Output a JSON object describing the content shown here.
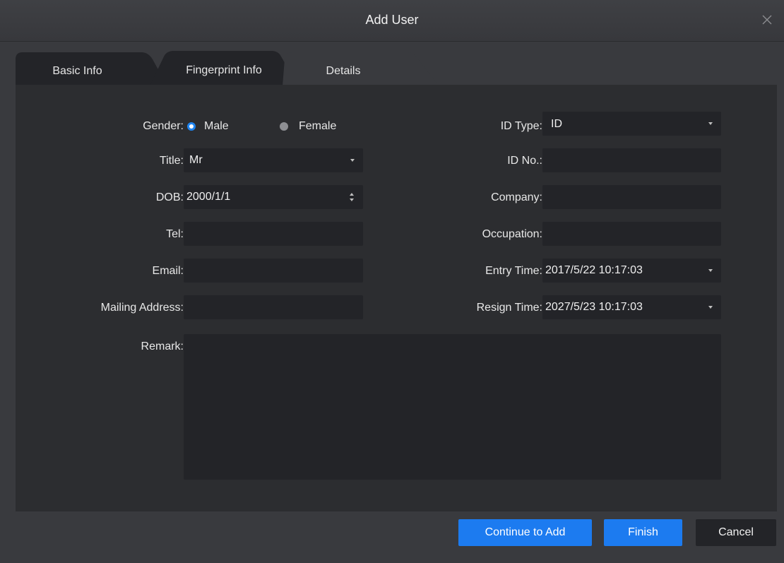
{
  "window": {
    "title": "Add User"
  },
  "tabs": [
    {
      "label": "Basic Info",
      "active": false
    },
    {
      "label": "Fingerprint Info",
      "active": false
    },
    {
      "label": "Details",
      "active": true
    }
  ],
  "form": {
    "gender": {
      "label": "Gender:",
      "options": [
        "Male",
        "Female"
      ],
      "selected": "Male"
    },
    "title": {
      "label": "Title:",
      "value": "Mr"
    },
    "dob": {
      "label": "DOB:",
      "value": "2000/1/1"
    },
    "tel": {
      "label": "Tel:",
      "value": ""
    },
    "email": {
      "label": "Email:",
      "value": ""
    },
    "mailing_address": {
      "label": "Mailing Address:",
      "value": ""
    },
    "remark": {
      "label": "Remark:",
      "value": ""
    },
    "id_type": {
      "label": "ID Type:",
      "value": "ID"
    },
    "id_no": {
      "label": "ID No.:",
      "value": ""
    },
    "company": {
      "label": "Company:",
      "value": ""
    },
    "occupation": {
      "label": "Occupation:",
      "value": ""
    },
    "entry_time": {
      "label": "Entry Time:",
      "value": "2017/5/22 10:17:03"
    },
    "resign_time": {
      "label": "Resign Time:",
      "value": "2027/5/23 10:17:03"
    }
  },
  "buttons": {
    "continue_label": "Continue to Add",
    "finish_label": "Finish",
    "cancel_label": "Cancel"
  },
  "colors": {
    "accent": "#1c7bf0",
    "background": "#393a3e",
    "panel": "#2c2d30",
    "field": "#232428"
  },
  "icons": {
    "close": "close-icon",
    "dropdown": "chevron-down-icon",
    "spinner": "spinner-arrows-icon"
  }
}
